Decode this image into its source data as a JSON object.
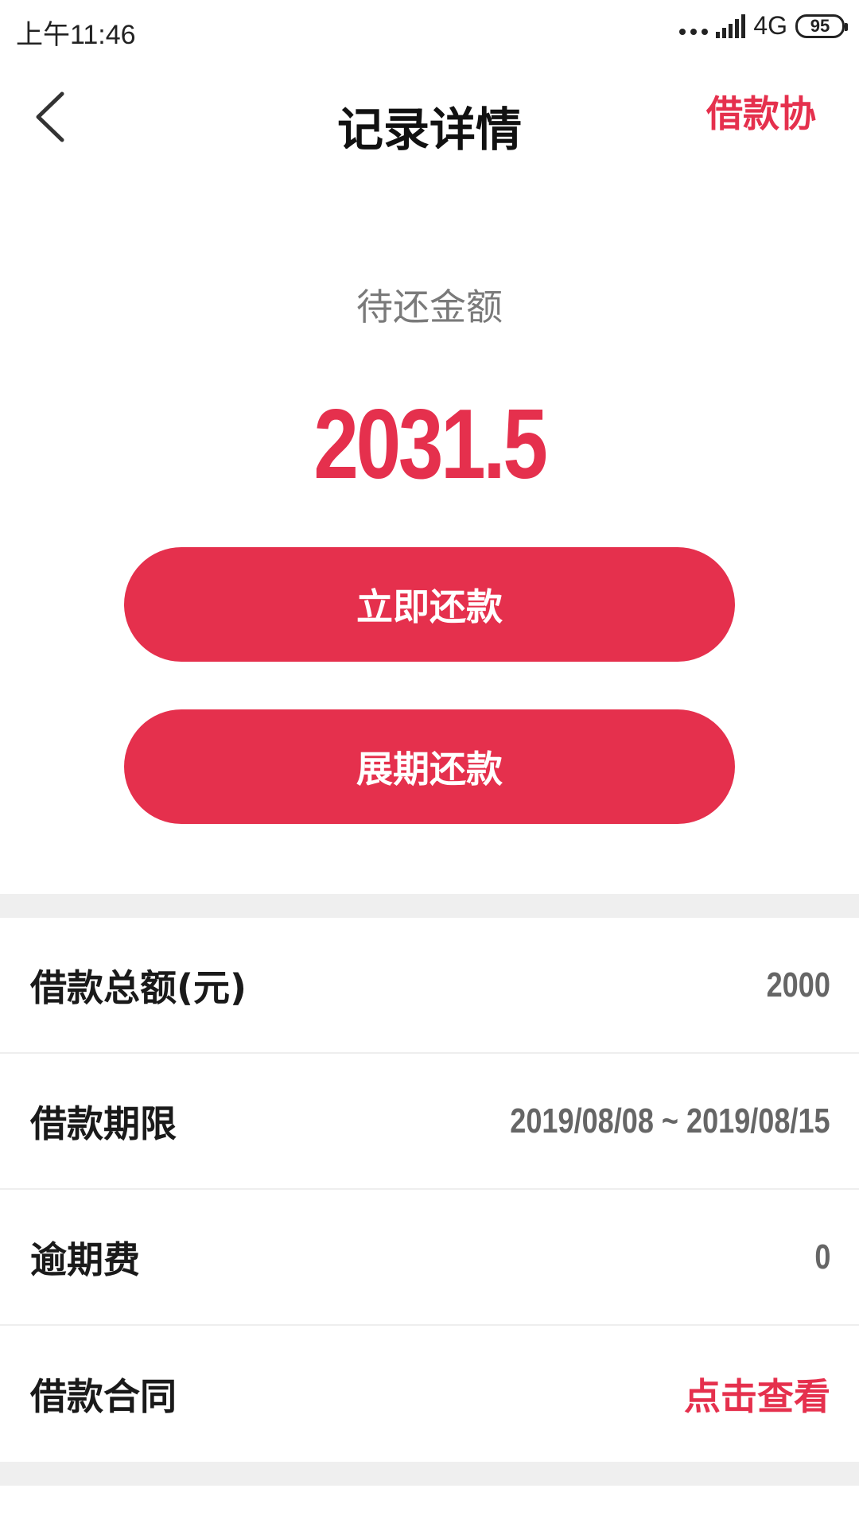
{
  "status_bar": {
    "time": "上午11:46",
    "network": "4G",
    "battery": "95"
  },
  "header": {
    "title": "记录详情",
    "right_link": "借款协议",
    "back_icon": "chevron-left-icon"
  },
  "summary": {
    "label": "待还金额",
    "amount": "2031.5"
  },
  "actions": {
    "repay_now": "立即还款",
    "extend_repay": "展期还款"
  },
  "details": [
    {
      "label": "借款总额(元)",
      "value": "2000"
    },
    {
      "label": "借款期限",
      "value": "2019/08/08 ~ 2019/08/15"
    },
    {
      "label": "逾期费",
      "value": "0"
    },
    {
      "label": "借款合同",
      "value": "点击查看"
    }
  ],
  "colors": {
    "accent": "#e5304d",
    "label_gray": "#7a7a7a",
    "value_gray": "#666666",
    "divider": "#efefef"
  }
}
